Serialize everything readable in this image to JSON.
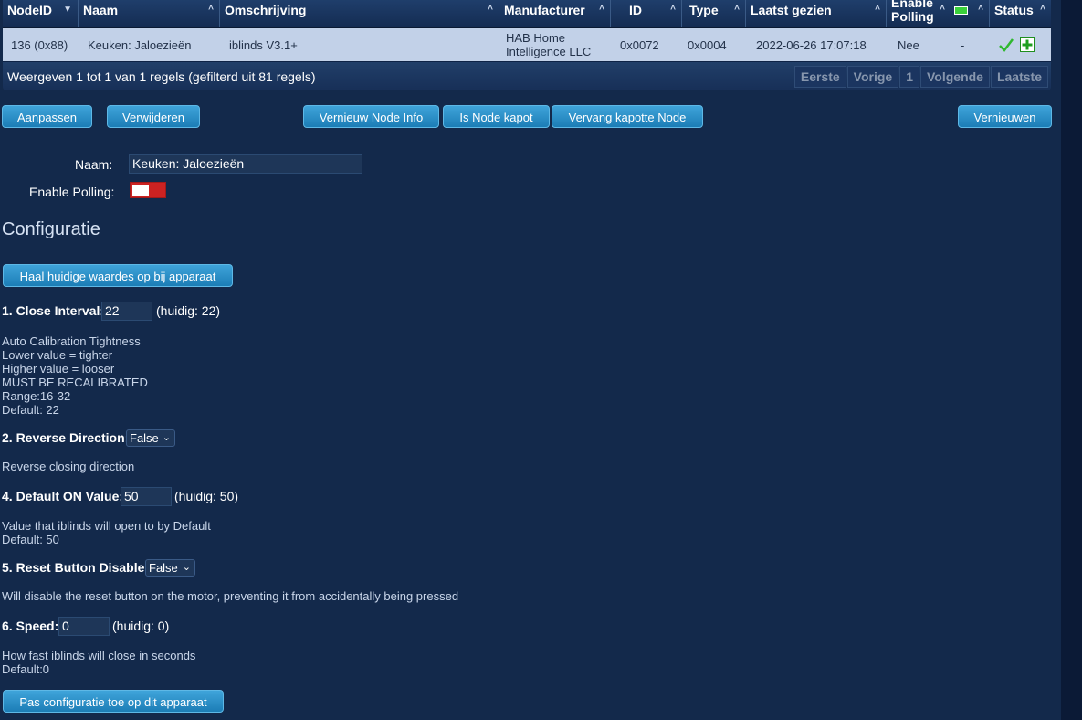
{
  "table": {
    "headers": {
      "nodeid": "NodeID",
      "naam": "Naam",
      "omschrijving": "Omschrijving",
      "manufacturer": "Manufacturer",
      "id": "ID",
      "type": "Type",
      "laatst_gezien": "Laatst gezien",
      "enable_polling_1": "Enable",
      "enable_polling_2": "Polling",
      "status": "Status"
    },
    "row": {
      "nodeid": "136 (0x88)",
      "naam": "Keuken: Jaloezieën",
      "omschrijving": "iblinds V3.1+",
      "manufacturer_1": "HAB Home",
      "manufacturer_2": "Intelligence LLC",
      "id": "0x0072",
      "type": "0x0004",
      "laatst_gezien": "2022-06-26 17:07:18",
      "enable_polling": "Nee",
      "battery": "-"
    },
    "info": "Weergeven 1 tot 1 van 1 regels (gefilterd uit 81 regels)",
    "pager": {
      "first": "Eerste",
      "prev": "Vorige",
      "page": "1",
      "next": "Volgende",
      "last": "Laatste"
    }
  },
  "actions": {
    "aanpassen": "Aanpassen",
    "verwijderen": "Verwijderen",
    "vernieuw_node_info": "Vernieuw Node Info",
    "is_node_kapot": "Is Node kapot",
    "vervang_kapotte_node": "Vervang kapotte Node",
    "vernieuwen": "Vernieuwen"
  },
  "form": {
    "naam_label": "Naam:",
    "naam_value": "Keuken: Jaloezieën",
    "polling_label": "Enable Polling:"
  },
  "config": {
    "title": "Configuratie",
    "fetch_button": "Haal huidige waardes op bij apparaat",
    "apply_button": "Pas configuratie toe op dit apparaat",
    "p1": {
      "label": "1. Close Interval:",
      "value": "22",
      "current": "(huidig: 22)",
      "desc": [
        "Auto Calibration Tightness",
        "Lower value = tighter",
        "Higher value = looser",
        "MUST BE RECALIBRATED",
        "Range:16-32",
        "Default: 22"
      ]
    },
    "p2": {
      "label": "2. Reverse Direction:",
      "value": "False",
      "desc": [
        "Reverse closing direction"
      ]
    },
    "p4": {
      "label": "4. Default ON Value:",
      "value": "50",
      "current": "(huidig: 50)",
      "desc": [
        "Value that iblinds will open to by Default",
        "Default: 50"
      ]
    },
    "p5": {
      "label": "5. Reset Button Disable:",
      "value": "False",
      "desc": [
        "Will disable the reset button on the motor, preventing it from accidentally being pressed"
      ]
    },
    "p6": {
      "label": "6. Speed:",
      "value": "0",
      "current": "(huidig: 0)",
      "desc": [
        "How fast iblinds will close in seconds",
        "Default:0"
      ]
    }
  },
  "colors": {
    "background": "#13294b",
    "button": "#2a8fc9",
    "row": "#c2d1e8",
    "toggle_off": "#cc2222",
    "ok": "#2fb82f"
  }
}
